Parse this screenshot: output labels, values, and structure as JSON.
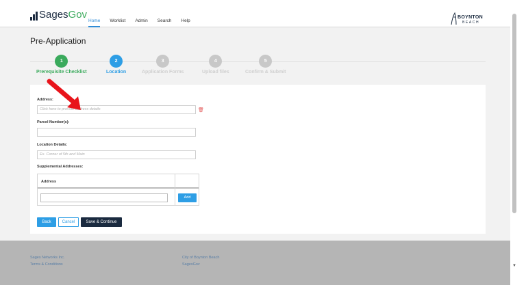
{
  "header": {
    "logo": "SagesGov",
    "nav": [
      {
        "label": "Home",
        "active": true
      },
      {
        "label": "Worklist",
        "active": false
      },
      {
        "label": "Admin",
        "active": false
      },
      {
        "label": "Search",
        "active": false
      },
      {
        "label": "Help",
        "active": false
      }
    ],
    "city_logo": {
      "line1": "BOYNTON",
      "line2": "BEACH"
    }
  },
  "page_title": "Pre-Application",
  "steps": [
    {
      "num": "1",
      "label": "Prerequisite Checklist",
      "state": "done"
    },
    {
      "num": "2",
      "label": "Location",
      "state": "current"
    },
    {
      "num": "3",
      "label": "Application Forms",
      "state": "todo"
    },
    {
      "num": "4",
      "label": "Upload files",
      "state": "todo"
    },
    {
      "num": "5",
      "label": "Confirm & Submit",
      "state": "todo"
    }
  ],
  "form": {
    "address_label": "Address:",
    "address_placeholder": "Click here to provide address details",
    "parcel_label": "Parcel Number(s):",
    "parcel_value": "",
    "location_label": "Location Details:",
    "location_placeholder": "Ex. Corner of 5th and Main",
    "supplemental_label": "Supplemental Addresses:",
    "table_header": "Address",
    "add_label": "Add"
  },
  "buttons": {
    "back": "Back",
    "cancel": "Cancel",
    "save": "Save & Continue"
  },
  "footer": {
    "col1": [
      "Sages Networks Inc.",
      "Terms & Conditions"
    ],
    "col2": [
      "City of Boynton Beach",
      "SagesGov"
    ]
  },
  "colors": {
    "accent": "#2e9ee5",
    "done": "#3aaa5c",
    "navy": "#1a2a3f",
    "arrow": "#e8141b"
  }
}
